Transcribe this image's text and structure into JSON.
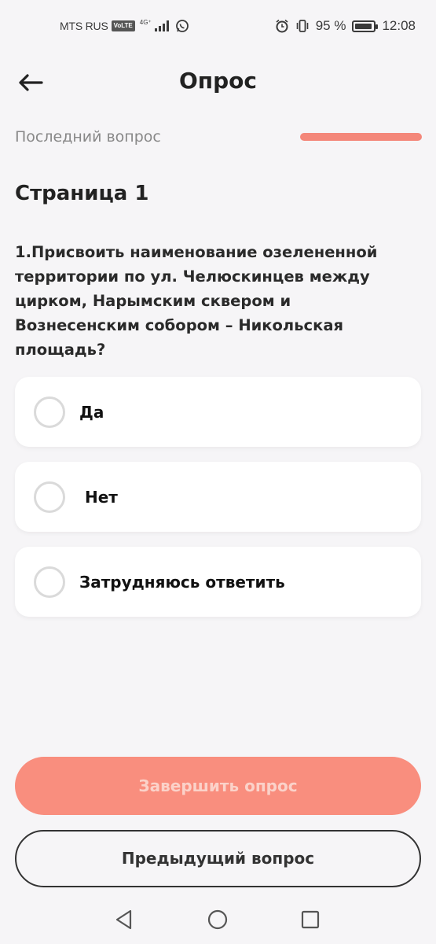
{
  "status_bar": {
    "carrier": "MTS RUS",
    "volte": "VoLTE",
    "network": "4G⁺",
    "battery": "95 %",
    "time": "12:08",
    "icons": [
      "whatsapp-icon",
      "alarm-icon",
      "vibrate-icon",
      "battery-icon",
      "signal-icon"
    ]
  },
  "header": {
    "title": "Опрос",
    "back_icon": "arrow-left-icon"
  },
  "progress": {
    "label": "Последний вопрос",
    "value": 1.0,
    "color": "#f4877a"
  },
  "page": {
    "section_title": "Страница 1",
    "question": "1.Присвоить наименование озелененной территории по ул. Челюскинцев между цирком, Нарымским сквером и Вознесенским собором – Никольская площадь?"
  },
  "options": [
    {
      "label": "Да",
      "selected": false
    },
    {
      "label": " Нет",
      "selected": false
    },
    {
      "label": "Затрудняюсь ответить",
      "selected": false
    }
  ],
  "actions": {
    "finish_label": "Завершить опрос",
    "previous_label": "Предыдущий вопрос"
  },
  "colors": {
    "accent": "#f98e7e",
    "background": "#f6f5f7"
  },
  "nav_icons": [
    "back-triangle-icon",
    "home-circle-icon",
    "recents-square-icon"
  ]
}
